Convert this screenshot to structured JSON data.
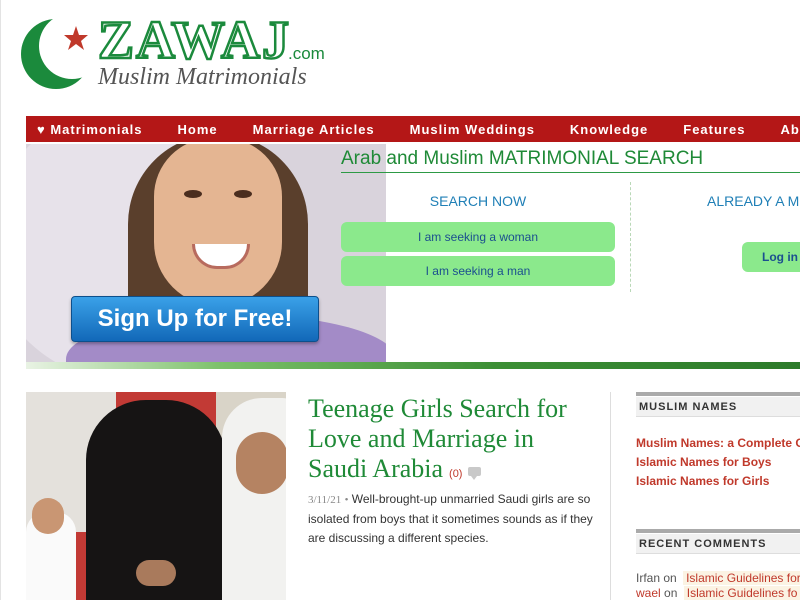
{
  "logo": {
    "wordmark": "ZAWAJ",
    "domain": ".com",
    "tagline": "Muslim Matrimonials"
  },
  "nav": {
    "items": [
      "♥ Matrimonials",
      "Home",
      "Marriage Articles",
      "Muslim Weddings",
      "Knowledge",
      "Features",
      "About"
    ]
  },
  "hero": {
    "signup_label": "Sign Up for Free!"
  },
  "search": {
    "title": "Arab and Muslim MATRIMONIAL SEARCH",
    "search_now": "SEARCH NOW",
    "seek_woman": "I am seeking a woman",
    "seek_man": "I am seeking a man",
    "already": "ALREADY A M",
    "login": "Log in"
  },
  "article": {
    "title": "Teenage Girls Search for Love and Marriage in Saudi Arabia",
    "comment_count": "(0)",
    "date": "3/11/21",
    "separator": "•",
    "excerpt": "Well-brought-up unmarried Saudi girls are so isolated from boys that it sometimes sounds as if they are discussing a different species."
  },
  "sidebar": {
    "names": {
      "heading": "MUSLIM NAMES",
      "links": [
        "Muslim Names: a Complete G",
        "Islamic Names for Boys",
        "Islamic Names for Girls"
      ]
    },
    "comments": {
      "heading": "RECENT COMMENTS",
      "items": [
        {
          "author": "Irfan",
          "on": "on",
          "link": "Islamic Guidelines for"
        },
        {
          "author": "wael",
          "on": "on",
          "link": "Islamic Guidelines fo"
        }
      ]
    }
  },
  "colors": {
    "brand_green": "#1f8a37",
    "nav_red": "#b41717",
    "link_red": "#c0392b",
    "button_green": "#8be98c",
    "signup_blue": "#1f7fd0"
  }
}
